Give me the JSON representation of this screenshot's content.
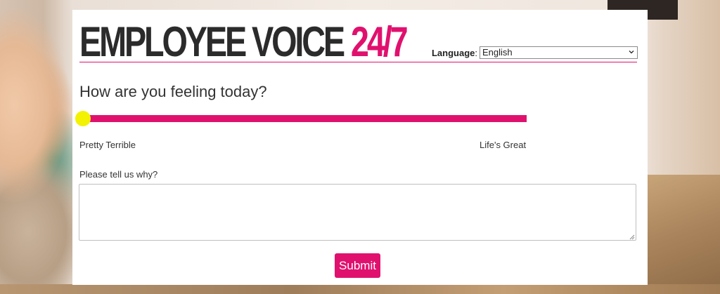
{
  "header": {
    "logo_main": "EMPLOYEE VOICE",
    "logo_number": "24/7",
    "language_label": "Language",
    "language_separator": ":",
    "language_value": "English",
    "language_icon": "chevron-down-icon"
  },
  "survey": {
    "question": "How are you feeling today?",
    "mood_level": 0,
    "min_label": "Pretty Terrible",
    "max_label": "Life's Great",
    "why_label": "Please tell us why?",
    "why_value": "",
    "submit_label": "Submit"
  },
  "colors": {
    "brand_pink": "#e0116e",
    "slider_thumb": "#f2f202",
    "logo_dark": "#2b2b2b"
  }
}
